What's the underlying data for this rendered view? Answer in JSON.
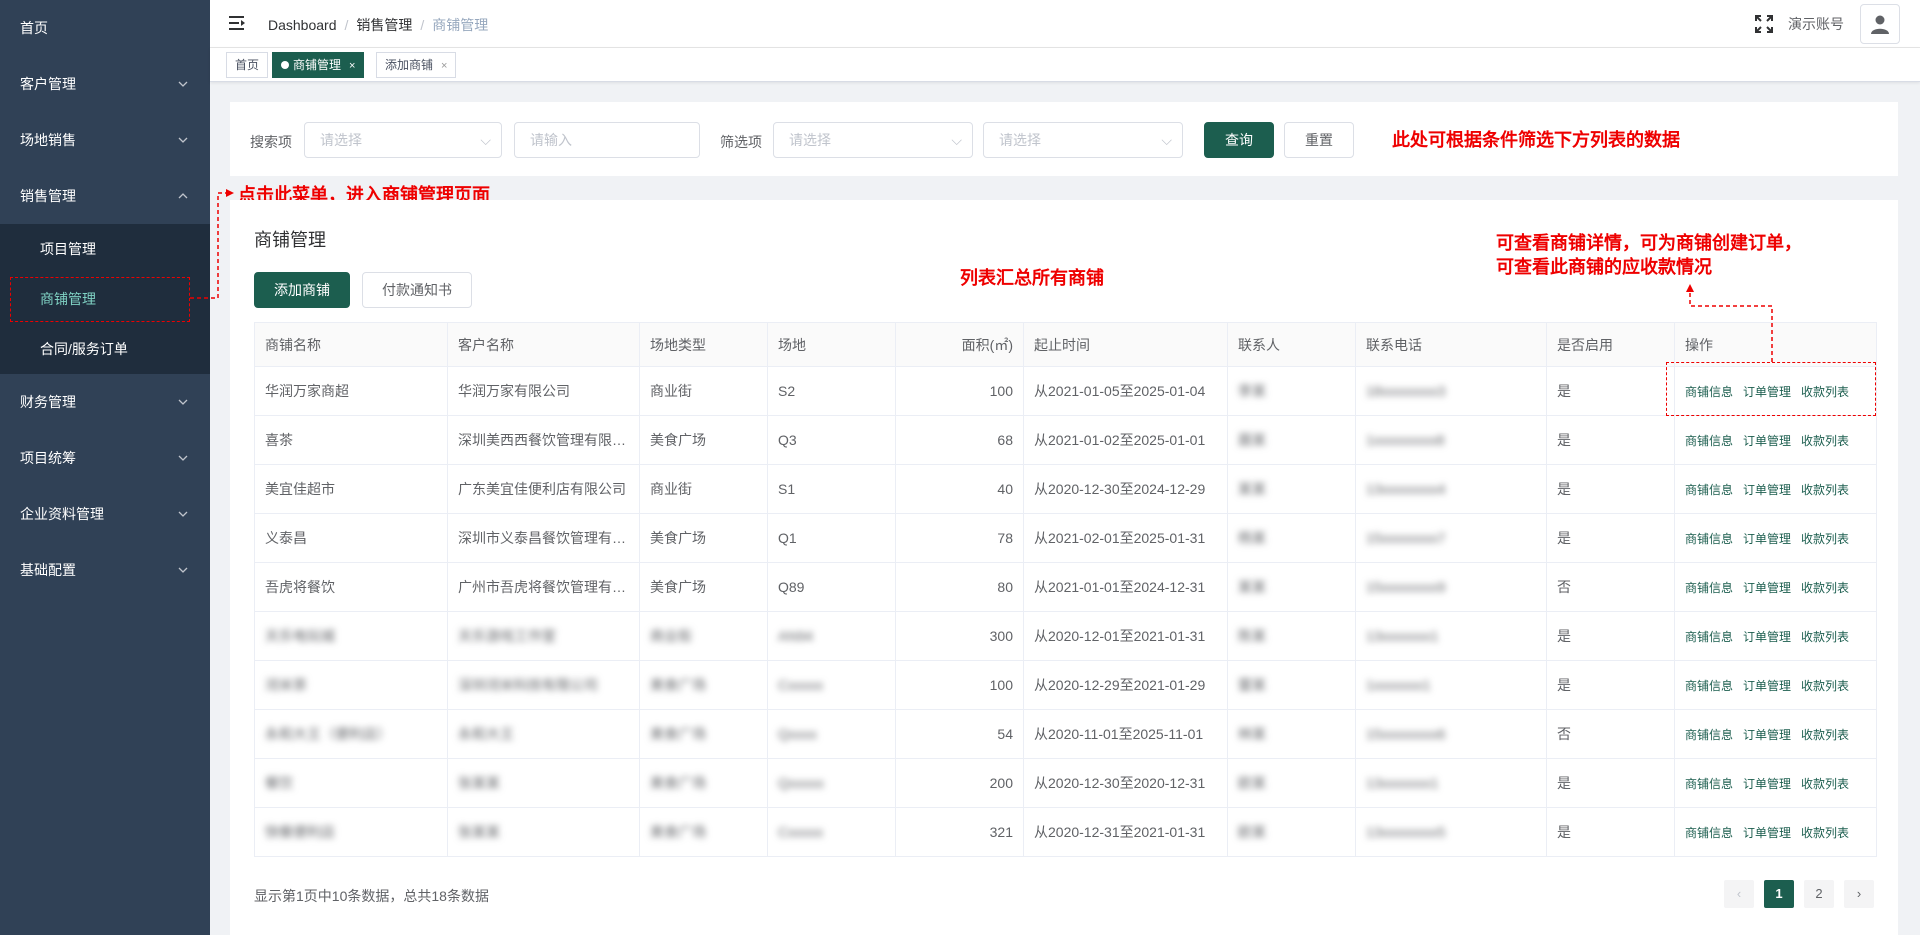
{
  "sidebar": {
    "items": [
      {
        "label": "首页",
        "has_arrow": false
      },
      {
        "label": "客户管理",
        "has_arrow": true
      },
      {
        "label": "场地销售",
        "has_arrow": true
      },
      {
        "label": "销售管理",
        "has_arrow": true,
        "expanded": true
      },
      {
        "label": "财务管理",
        "has_arrow": true
      },
      {
        "label": "项目统筹",
        "has_arrow": true
      },
      {
        "label": "企业资料管理",
        "has_arrow": true
      },
      {
        "label": "基础配置",
        "has_arrow": true
      }
    ],
    "sub_items": [
      {
        "label": "项目管理"
      },
      {
        "label": "商铺管理",
        "active": true
      },
      {
        "label": "合同/服务订单"
      }
    ]
  },
  "header": {
    "breadcrumb": [
      "Dashboard",
      "销售管理",
      "商铺管理"
    ],
    "account": "演示账号"
  },
  "tags": [
    {
      "label": "首页"
    },
    {
      "label": "商铺管理",
      "active": true
    },
    {
      "label": "添加商铺"
    }
  ],
  "filter": {
    "search_label": "搜索项",
    "search_select_placeholder": "请选择",
    "search_input_placeholder": "请输入",
    "filter_label": "筛选项",
    "filter_select1_placeholder": "请选择",
    "filter_select2_placeholder": "请选择",
    "query_button": "查询",
    "reset_button": "重置"
  },
  "annotations": {
    "filter_note": "此处可根据条件筛选下方列表的数据",
    "menu_note": "点击此菜单，进入商铺管理页面",
    "list_note": "列表汇总所有商铺",
    "ops_note_line1": "可查看商铺详情，可为商铺创建订单，",
    "ops_note_line2": "可查看此商铺的应收款情况"
  },
  "card": {
    "title": "商铺管理",
    "add_button": "添加商铺",
    "notice_button": "付款通知书"
  },
  "table": {
    "columns": [
      "商铺名称",
      "客户名称",
      "场地类型",
      "场地",
      "面积(㎡)",
      "起止时间",
      "联系人",
      "联系电话",
      "是否启用",
      "操作"
    ],
    "ops": [
      "商铺信息",
      "订单管理",
      "收款列表"
    ],
    "rows": [
      [
        "华润万家商超",
        "华润万家有限公司",
        "商业街",
        "S2",
        "100",
        "从2021-01-05至2025-01-04",
        "李某",
        "18xxxxxxxx3",
        "是"
      ],
      [
        "喜茶",
        "深圳美西西餐饮管理有限公司",
        "美食广场",
        "Q3",
        "68",
        "从2021-01-02至2025-01-01",
        "聂某",
        "1xxxxxxxxx8",
        "是"
      ],
      [
        "美宜佳超市",
        "广东美宜佳便利店有限公司",
        "商业街",
        "S1",
        "40",
        "从2020-12-30至2024-12-29",
        "某某",
        "13xxxxxxxx4",
        "是"
      ],
      [
        "义泰昌",
        "深圳市义泰昌餐饮管理有限公司",
        "美食广场",
        "Q1",
        "78",
        "从2021-02-01至2025-01-31",
        "杨某",
        "15xxxxxxxx7",
        "是"
      ],
      [
        "吾虎将餐饮",
        "广州市吾虎将餐饮管理有限公司",
        "美食广场",
        "Q89",
        "80",
        "从2021-01-01至2024-12-31",
        "某某",
        "15xxxxxxxx9",
        "否"
      ],
      [
        "天乐电玩城",
        "天乐游戏工作室",
        "商业街",
        "AN94",
        "300",
        "从2020-12-01至2021-01-31",
        "陈某",
        "13xxxxxxx1",
        "是"
      ],
      [
        "沏米茶",
        "深圳沏米科技有限公司",
        "美食广场",
        "Cxxxxx",
        "100",
        "从2020-12-29至2021-01-29",
        "雷某",
        "1xxxxxxx1",
        "是"
      ],
      [
        "永和大王（便利店）",
        "永和大王",
        "美食广场",
        "Qxxxx",
        "54",
        "从2020-11-01至2025-11-01",
        "林某",
        "15xxxxxxxx6",
        "否"
      ],
      [
        "餐饮",
        "张某某",
        "美食广场",
        "Qxxxxx",
        "200",
        "从2020-12-30至2020-12-31",
        "欧某",
        "13xxxxxxx1",
        "是"
      ],
      [
        "快餐便利店",
        "张某某",
        "美食广场",
        "Cxxxxx",
        "321",
        "从2020-12-31至2021-01-31",
        "欧某",
        "13xxxxxxxx5",
        "是"
      ]
    ]
  },
  "pagination": {
    "info_prefix": "显示第",
    "page": "1",
    "info_mid": "页中",
    "count": "10",
    "info_mid2": "条数据，总共",
    "total": "18",
    "info_suffix": "条数据",
    "pages": [
      "1",
      "2"
    ],
    "prev": "‹",
    "next": "›"
  },
  "colors": {
    "sidebar_bg": "#304156",
    "primary": "#1c5e4f",
    "annotation": "#ee0000"
  }
}
